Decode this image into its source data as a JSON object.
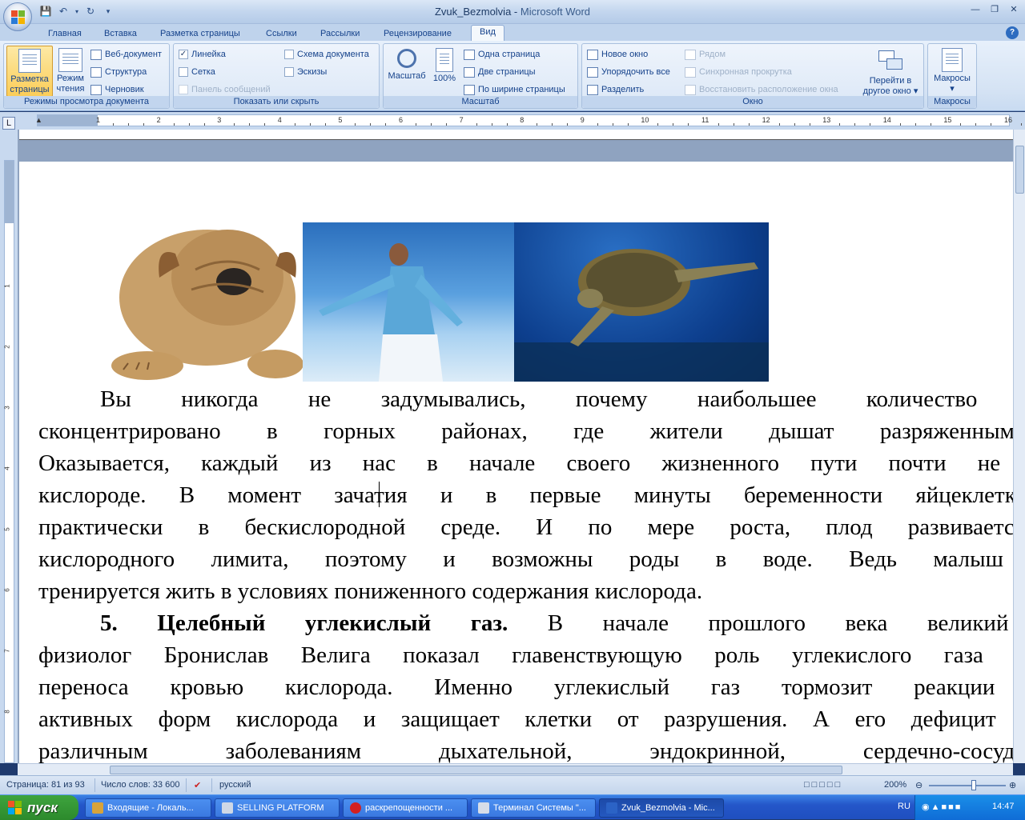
{
  "window": {
    "doc_name": "Zvuk_Bezmolvia",
    "separator": " - ",
    "app_name": "Microsoft Word"
  },
  "tabs": [
    "Главная",
    "Вставка",
    "Разметка страницы",
    "Ссылки",
    "Рассылки",
    "Рецензирование",
    "Вид"
  ],
  "active_tab": "Вид",
  "help_label": "?",
  "ribbon": {
    "views": {
      "label": "Режимы просмотра документа",
      "print_layout": "Разметка страницы",
      "reading": "Режим чтения",
      "web": "Веб-документ",
      "outline": "Структура",
      "draft": "Черновик"
    },
    "show_hide": {
      "label": "Показать или скрыть",
      "ruler": "Линейка",
      "ruler_checked": true,
      "grid": "Сетка",
      "message_bar": "Панель сообщений",
      "doc_map": "Схема документа",
      "thumbnails": "Эскизы"
    },
    "zoom": {
      "label": "Масштаб",
      "zoom_btn": "Масштаб",
      "hundred": "100%",
      "one_page": "Одна страница",
      "two_pages": "Две страницы",
      "page_width": "По ширине страницы"
    },
    "window": {
      "label": "Окно",
      "new_window": "Новое окно",
      "arrange_all": "Упорядочить все",
      "split": "Разделить",
      "side_by_side": "Рядом",
      "sync_scroll": "Синхронная прокрутка",
      "reset_pos": "Восстановить расположение окна",
      "switch": "Перейти в другое окно"
    },
    "macros": {
      "label": "Макросы",
      "macros_btn": "Макросы"
    }
  },
  "ruler_numbers": [
    "1",
    "2",
    "3",
    "4",
    "5",
    "6",
    "7",
    "8",
    "9",
    "10",
    "11",
    "12",
    "13",
    "14",
    "15",
    "16"
  ],
  "ruler_numbers_v": [
    "1",
    "2",
    "3",
    "4",
    "5",
    "6",
    "7",
    "8"
  ],
  "document": {
    "p1_lines": [
      "Вы никогда не задумывались,  почему наибольшее количество долг",
      "сконцентрировано в горных районах, где жители дышат разряженным в",
      "Оказывается, каждый из нас в начале своего жизненного пути почти не нуж",
      "кислороде. В момент зачатия и в первые минуты беременности яйцеклетка н",
      "практически в бескислородной среде. И по мере роста, плод развивается в",
      "кислородного лимита, поэтому и возможны роды в воде. Ведь малыш все",
      "тренируется жить в условиях пониженного содержания кислорода."
    ],
    "p2_heading": "5. Целебный углекислый  газ.",
    "p2_lines": [
      " В начале прошлого века великий ро",
      "физиолог Бронислав Велига показал главенствующую роль углекислого газа в п",
      "переноса кровью кислорода. Именно углекислый газ тормозит реакции обр",
      "активных форм кислорода и защищает клетки от разрушения. А его дефицит и п",
      "различным заболеваниям дыхательной, эндокринной, сердечно-сосудистой"
    ]
  },
  "status": {
    "page": "Страница: 81 из 93",
    "words": "Число слов: 33 600",
    "language": "русский",
    "zoom": "200%"
  },
  "taskbar": {
    "start": "пуск",
    "tasks": [
      {
        "label": "Входящие - Локаль...",
        "icon_color": "#d8a33a"
      },
      {
        "label": "SELLING PLATFORM",
        "icon_color": "#cfd8e6"
      },
      {
        "label": "раскрепощенности ...",
        "icon_color": "#d32020"
      },
      {
        "label": "Терминал Системы \"...",
        "icon_color": "#d7dde8"
      },
      {
        "label": "Zvuk_Bezmolvia - Mic...",
        "icon_color": "#2b63c6"
      }
    ],
    "active_task": 4,
    "lang": "RU",
    "time": "14:47"
  },
  "colors": {
    "ribbon_active": "#fbcd58",
    "taskbar": "#2456c9",
    "start_green": "#2c8a2c"
  }
}
